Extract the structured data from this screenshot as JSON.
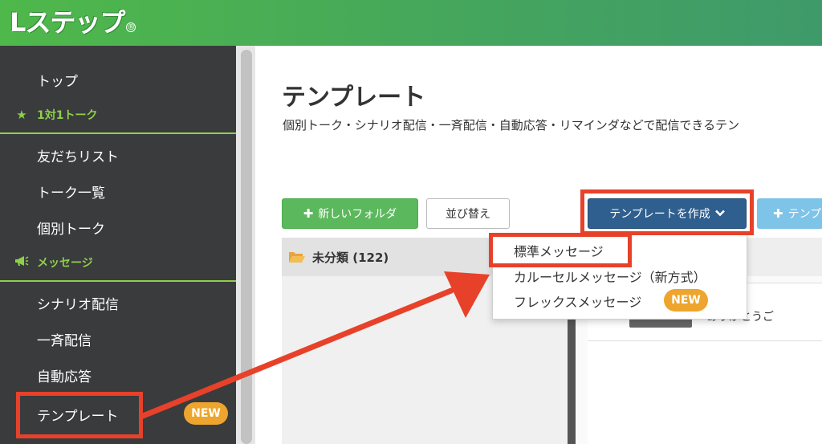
{
  "header": {
    "logo_text": "Lステップ",
    "logo_mark": "®"
  },
  "sidebar": {
    "top_item": "トップ",
    "section_chat": {
      "label": "1対1トーク",
      "icon": "star-icon"
    },
    "chat_items": [
      "友だちリスト",
      "トーク一覧",
      "個別トーク"
    ],
    "section_message": {
      "label": "メッセージ",
      "icon": "megaphone-icon"
    },
    "message_items": [
      "シナリオ配信",
      "一斉配信",
      "自動応答",
      "テンプレート"
    ],
    "template_badge": "NEW"
  },
  "main": {
    "title": "テンプレート",
    "description": "個別トーク・シナリオ配信・一斉配信・自動応答・リマインダなどで配信できるテン",
    "buttons": {
      "new_folder": "新しいフォルダ",
      "sort": "並び替え",
      "create_template": "テンプレートを作成",
      "extra": "テンプ"
    },
    "folder": {
      "label": "未分類 (122)"
    },
    "card_text": "ありがとうご"
  },
  "dropdown": {
    "items": [
      "標準メッセージ",
      "カルーセルメッセージ（新方式）",
      "フレックスメッセージ"
    ],
    "flex_badge": "NEW"
  },
  "colors": {
    "header_green": "#4fb84a",
    "sidebar_bg": "#3a3b3d",
    "accent_green": "#8fcf4b",
    "create_button": "#2f5f8f",
    "highlight_red": "#e8412a",
    "badge_orange": "#eda52e"
  }
}
